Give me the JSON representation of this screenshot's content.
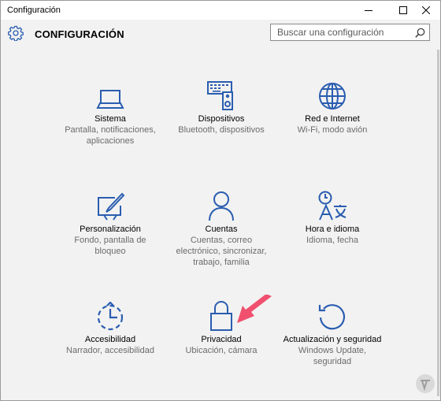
{
  "window": {
    "title": "Configuración"
  },
  "header": {
    "title": "CONFIGURACIÓN",
    "search_placeholder": "Buscar una configuración"
  },
  "tiles": [
    {
      "name": "Sistema",
      "desc": [
        "Pantalla, notificaciones,",
        "aplicaciones"
      ],
      "icon": "laptop-icon"
    },
    {
      "name": "Dispositivos",
      "desc": [
        "Bluetooth, dispositivos"
      ],
      "icon": "devices-icon"
    },
    {
      "name": "Red e Internet",
      "desc": [
        "Wi-Fi, modo avión"
      ],
      "icon": "globe-icon"
    },
    {
      "name": "Personalización",
      "desc": [
        "Fondo, pantalla de",
        "bloqueo"
      ],
      "icon": "paint-icon"
    },
    {
      "name": "Cuentas",
      "desc": [
        "Cuentas, correo",
        "electrónico, sincronizar,",
        "trabajo, familia"
      ],
      "icon": "person-icon"
    },
    {
      "name": "Hora e idioma",
      "desc": [
        "Idioma, fecha"
      ],
      "icon": "time-language-icon"
    },
    {
      "name": "Accesibilidad",
      "desc": [
        "Narrador, accesibilidad"
      ],
      "icon": "accessibility-icon"
    },
    {
      "name": "Privacidad",
      "desc": [
        "Ubicación, cámara"
      ],
      "icon": "lock-icon"
    },
    {
      "name": "Actualización y seguridad",
      "desc": [
        "Windows Update,",
        "seguridad"
      ],
      "icon": "update-icon"
    }
  ],
  "colors": {
    "accent": "#2a5db0",
    "arrow": "#f0506e",
    "background": "#f2f2f2"
  }
}
